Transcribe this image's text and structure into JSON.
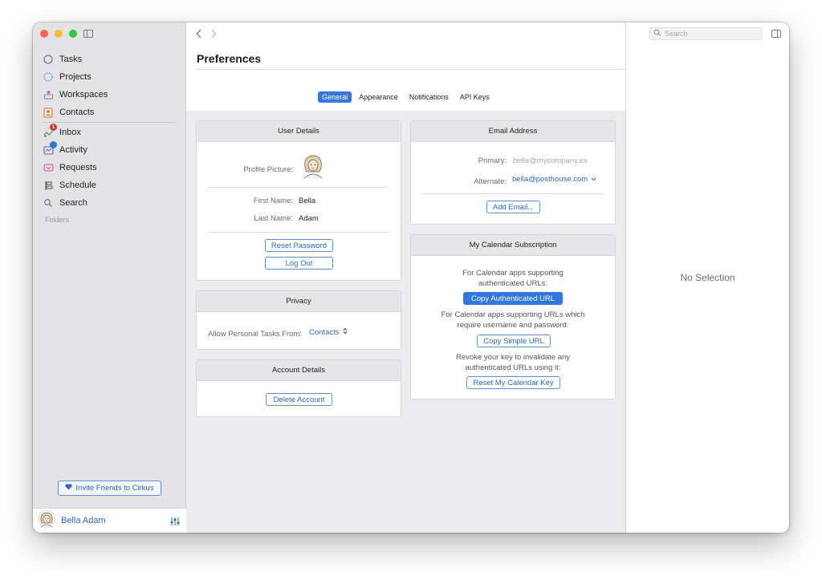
{
  "sidebar": {
    "items": [
      {
        "label": "Tasks",
        "icon": "circle-icon"
      },
      {
        "label": "Projects",
        "icon": "dotted-circle-icon"
      },
      {
        "label": "Workspaces",
        "icon": "workspaces-icon"
      },
      {
        "label": "Contacts",
        "icon": "contacts-icon"
      },
      {
        "label": "Inbox",
        "icon": "inbox-icon",
        "badge": "1"
      },
      {
        "label": "Activity",
        "icon": "activity-icon"
      },
      {
        "label": "Requests",
        "icon": "requests-icon"
      },
      {
        "label": "Schedule",
        "icon": "schedule-icon"
      },
      {
        "label": "Search",
        "icon": "search-icon"
      }
    ],
    "folders_label": "Folders",
    "invite_label": "Invite Friends to Cirkus",
    "user_name": "Bella Adam"
  },
  "main": {
    "title": "Preferences",
    "tabs": [
      "General",
      "Appearance",
      "Notifications",
      "API Keys"
    ],
    "active_tab": "General",
    "user_details": {
      "title": "User Details",
      "profile_picture_label": "Profile Picture:",
      "first_name_label": "First Name:",
      "first_name": "Bella",
      "last_name_label": "Last Name:",
      "last_name": "Adam",
      "reset_password": "Reset Password",
      "log_out": "Log Out"
    },
    "privacy": {
      "title": "Privacy",
      "allow_label": "Allow Personal Tasks From:",
      "allow_value": "Contacts"
    },
    "account_details": {
      "title": "Account Details",
      "delete_account": "Delete Account"
    },
    "email": {
      "title": "Email Address",
      "primary_label": "Primary:",
      "primary_value": "bella@mycompany.ex",
      "alternate_label": "Alternate:",
      "alternate_value": "bella@posthouse.com",
      "add_email": "Add Email..."
    },
    "calendar": {
      "title": "My Calendar Subscription",
      "auth_text_1": "For Calendar apps supporting",
      "auth_text_2": "authenticated URLs:",
      "copy_auth": "Copy Authenticated URL",
      "simple_text_1": "For Calendar apps supporting URLs which",
      "simple_text_2": "require username and password:",
      "copy_simple": "Copy Simple URL",
      "revoke_text_1": "Revoke your key to invalidate any",
      "revoke_text_2": "authenticated URLs using it:",
      "reset_key": "Reset My Calendar Key"
    }
  },
  "inspector": {
    "search_placeholder": "Search",
    "empty_text": "No Selection"
  },
  "colors": {
    "accent": "#2f77e0",
    "sidebar_bg": "#e3e3e6",
    "badge_red": "#d8323a",
    "badge_blue": "#2f77e0"
  }
}
